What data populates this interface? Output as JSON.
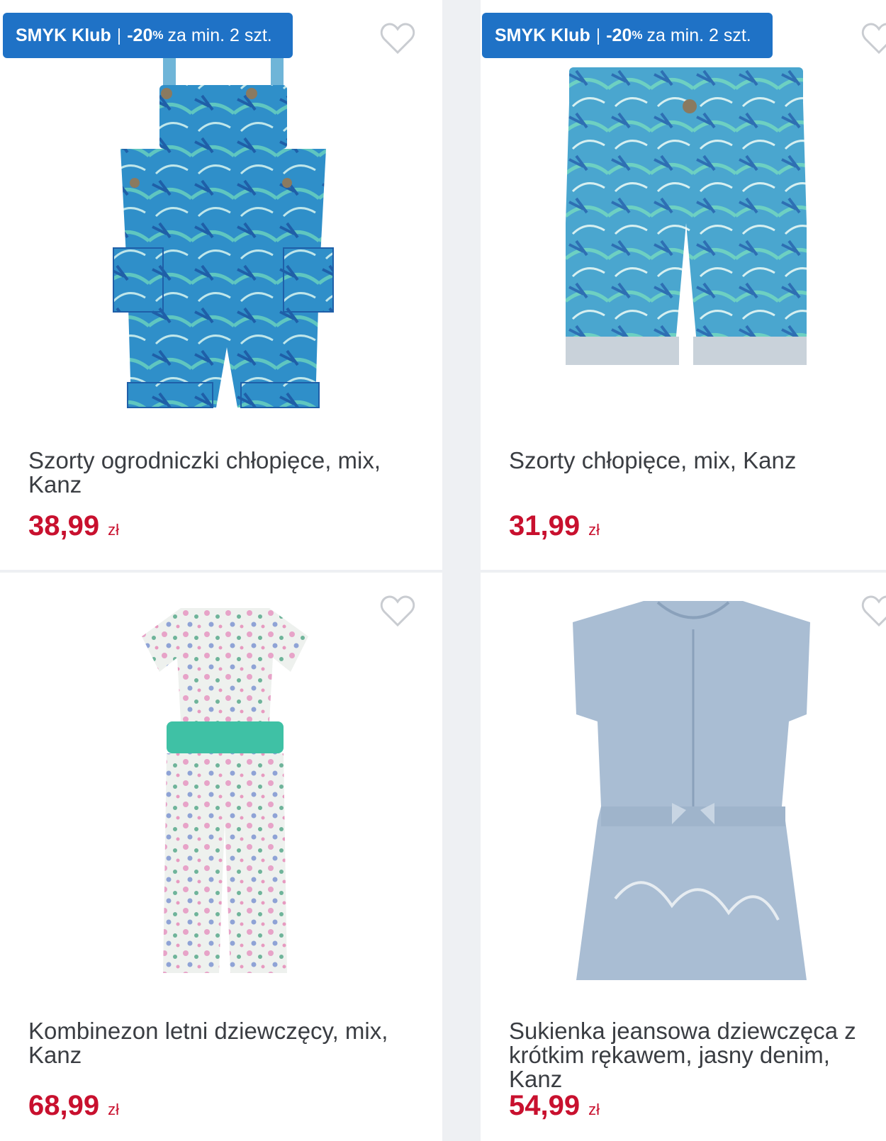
{
  "products": [
    {
      "badge": {
        "brand": "SMYK Klub",
        "separator": "|",
        "discount": "-20",
        "percent": "%",
        "rest": "za min. 2 szt."
      },
      "title": "Szorty ogrodniczki chłopięce, mix, Kanz",
      "price": "38,99",
      "currency": "zł",
      "image": "overalls-shorts-palm-print"
    },
    {
      "badge": {
        "brand": "SMYK Klub",
        "separator": "|",
        "discount": "-20",
        "percent": "%",
        "rest": "za min. 2 szt."
      },
      "title": "Szorty chłopięce, mix, Kanz",
      "price": "31,99",
      "currency": "zł",
      "image": "shorts-palm-print"
    },
    {
      "title": "Kombinezon letni dziewczęcy, mix, Kanz",
      "price": "68,99",
      "currency": "zł",
      "image": "floral-jumpsuit"
    },
    {
      "title": "Sukienka jeansowa dziewczęca z krótkim rękawem, jasny denim, Kanz",
      "price": "54,99",
      "currency": "zł",
      "image": "light-denim-dress"
    }
  ],
  "colors": {
    "badge_bg": "#1f72c6",
    "price": "#c8102e",
    "heart": "#c9ccd1"
  }
}
